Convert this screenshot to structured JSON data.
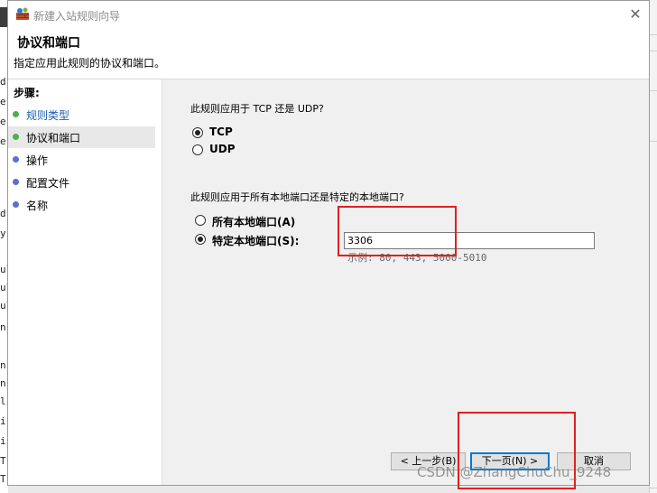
{
  "background": {
    "left_chars": [
      "d",
      "e",
      "e",
      "e",
      "d",
      "y",
      "ul",
      "ul",
      "ul",
      "n",
      "n",
      "n",
      "l",
      "i",
      "i",
      "T",
      "T"
    ]
  },
  "window": {
    "title": "新建入站规则向导",
    "close_glyph": "✕"
  },
  "header": {
    "title": "协议和端口",
    "subtitle": "指定应用此规则的协议和端口。"
  },
  "steps": {
    "heading": "步骤:",
    "items": [
      {
        "label": "规则类型",
        "state": "link"
      },
      {
        "label": "协议和端口",
        "state": "current"
      },
      {
        "label": "操作",
        "state": "pending"
      },
      {
        "label": "配置文件",
        "state": "pending"
      },
      {
        "label": "名称",
        "state": "pending"
      }
    ]
  },
  "protocol": {
    "question": "此规则应用于 TCP 还是 UDP?",
    "tcp_label": "TCP",
    "udp_label": "UDP",
    "selected": "TCP"
  },
  "ports": {
    "question": "此规则应用于所有本地端口还是特定的本地端口?",
    "all_label": "所有本地端口(A)",
    "specific_label": "特定本地端口(S):",
    "value": "3306",
    "example": "示例: 80, 443, 5000-5010",
    "selected": "specific"
  },
  "buttons": {
    "back": "< 上一步(B)",
    "next": "下一页(N) >",
    "cancel": "取消"
  },
  "watermark": "CSDN @ZhangChuChu_9248",
  "colors": {
    "annotation": "#e02020",
    "link": "#1a5fb4",
    "step_done": "#4caf50",
    "step_pending": "#5b6fd1"
  }
}
